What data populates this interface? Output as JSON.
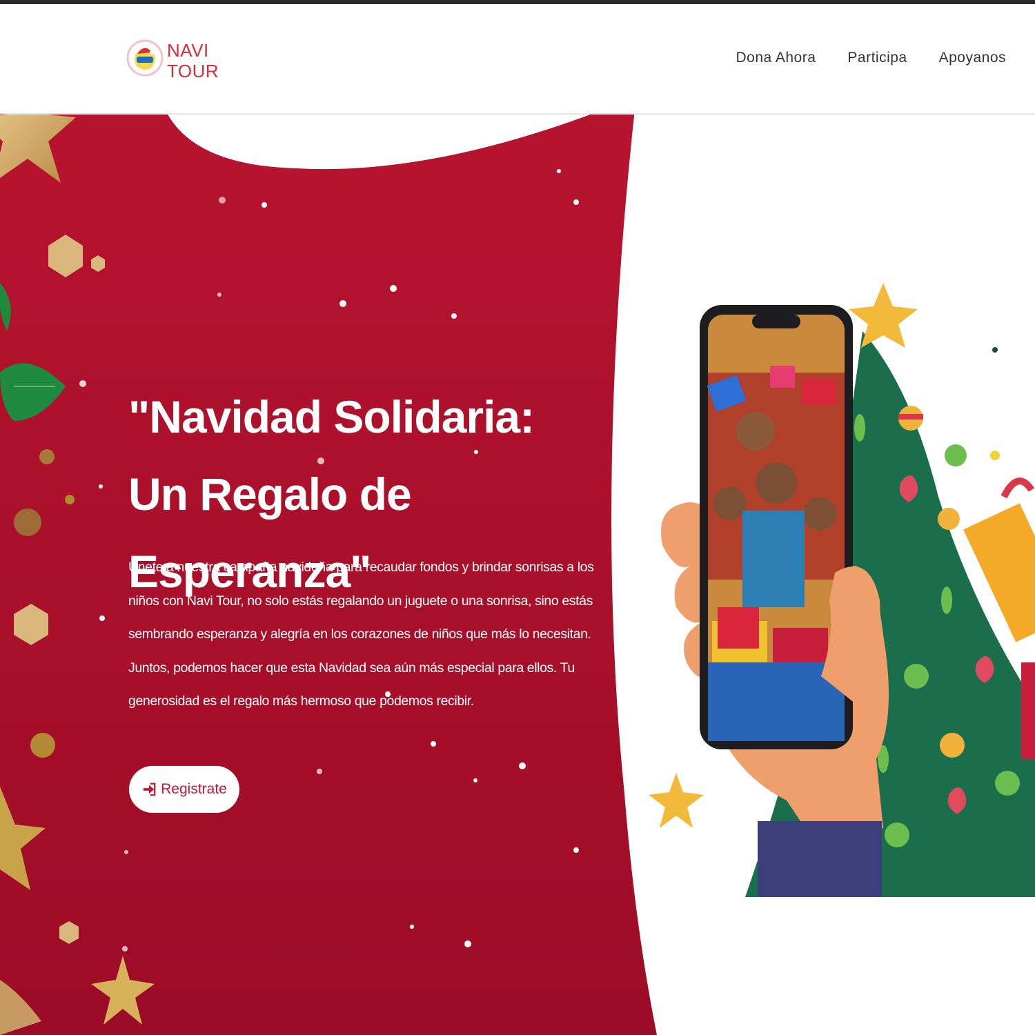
{
  "brand": {
    "logo_line1": "NAVI",
    "logo_line2": "TOUR",
    "accent_color": "#d92d3a",
    "hero_color": "#b0102e"
  },
  "nav": {
    "items": [
      "Dona Ahora",
      "Participa",
      "Apoyanos"
    ]
  },
  "hero": {
    "title": "\"Navidad Solidaria: Un Regalo de Esperanza\"",
    "description": "Únete a nuestra campaña navideña para recaudar fondos y brindar sonrisas a los niños con Navi Tour, no solo estás regalando un juguete o una sonrisa, sino estás sembrando esperanza y alegría en los corazones de niños que más lo necesitan. Juntos, podemos hacer que esta Navidad sea aún más especial para ellos. Tu generosidad es el regalo más hermoso que podemos recibir.",
    "cta_label": "Registrate",
    "cta_icon": "sign-in-icon"
  },
  "illustration": {
    "subject": "hand-holding-phone-icon",
    "decor": [
      "christmas-tree-icon",
      "star-icon",
      "gift-icon"
    ]
  }
}
